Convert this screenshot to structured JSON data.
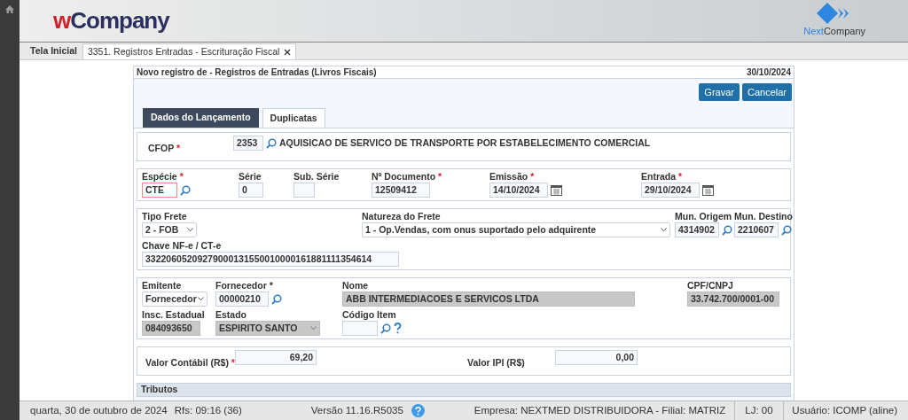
{
  "header": {
    "logo": {
      "accent": "w",
      "text": "Company"
    },
    "brand": {
      "accent": "Next",
      "text": "Company"
    }
  },
  "tabs": [
    {
      "label": "Tela Inicial",
      "selected": false
    },
    {
      "label": "3351. Registros Entradas - Escrituração Fiscal",
      "selected": true,
      "closable": true
    }
  ],
  "form": {
    "title": "Novo registro de - Registros de Entradas (Livros Fiscais)",
    "date": "30/10/2024",
    "buttons": [
      "Gravar",
      "Cancelar"
    ],
    "tabs": [
      {
        "label": "Dados do Lançamento",
        "selected": true
      },
      {
        "label": "Duplicatas",
        "selected": false
      }
    ],
    "sections": [
      {
        "kind": "inline",
        "rows": [
          [
            {
              "label": "CFOP",
              "mark": "*",
              "kind": "input",
              "value": "2353",
              "search": true,
              "description": "AQUISICAO DE SERVICO DE TRANSPORTE POR ESTABELECIMENTO COMERCIAL"
            }
          ]
        ]
      },
      {
        "kind": "stacked",
        "rows": [
          [
            {
              "label": "Espécie",
              "mark": "*",
              "kind": "input",
              "value": "CTE",
              "invalid": true,
              "search": true
            },
            {
              "label": "Série",
              "kind": "input",
              "value": "0"
            },
            {
              "label": "Sub. Série",
              "kind": "input"
            },
            {
              "label": "Nº Documento",
              "mark": "*",
              "kind": "input",
              "value": "12509412"
            },
            {
              "label": "Emissão",
              "mark": "*",
              "kind": "date",
              "value": "14/10/2024"
            },
            {
              "label": "Entrada",
              "mark": "*",
              "kind": "date",
              "value": "29/10/2024"
            }
          ]
        ]
      },
      {
        "kind": "stacked",
        "rows": [
          [
            {
              "label": "Tipo Frete",
              "kind": "select",
              "value": "2 - FOB"
            },
            {
              "label": "Natureza do Frete",
              "kind": "select",
              "value": "1 - Op.Vendas, com onus suportado pelo adquirente"
            },
            {
              "label": "Mun. Origem",
              "kind": "input",
              "value": "4314902",
              "search": true
            },
            {
              "label": "Mun. Destino",
              "kind": "input",
              "value": "2210607",
              "search": true
            }
          ],
          [
            {
              "label": "Chave NF-e / CT-e",
              "kind": "input",
              "value": "33220605209279000131550010000161881111354614"
            }
          ]
        ]
      },
      {
        "kind": "stacked",
        "rows": [
          [
            {
              "label": "Emitente",
              "kind": "select",
              "value": "Fornecedor"
            },
            {
              "label": "Fornecedor *",
              "kind": "input",
              "value": "00000210",
              "search": true
            },
            {
              "label": "Nome",
              "kind": "readonly",
              "value": "ABB INTERMEDIACOES E SERVICOS LTDA"
            },
            {
              "label": "CPF/CNPJ",
              "kind": "readonly",
              "value": "33.742.700/0001-00"
            }
          ],
          [
            {
              "label": "Insc. Estadual",
              "kind": "readonly",
              "value": "084093650"
            },
            {
              "label": "Estado",
              "kind": "readonly_select",
              "value": "ESPIRITO SANTO"
            },
            {
              "label": "Código Item",
              "kind": "input",
              "search": true,
              "help": true
            }
          ]
        ]
      },
      {
        "kind": "inline",
        "rows": [
          [
            {
              "label": "Valor Contábil (R$)",
              "mark": "*",
              "kind": "amount",
              "value": "69,20"
            },
            {
              "label": "Valor IPI (R$)",
              "kind": "amount",
              "value": "0,00"
            }
          ]
        ]
      }
    ],
    "tributos": {
      "title": "Tributos"
    }
  },
  "status_bar": {
    "date": "quarta, 30 de outubro de 2024",
    "refresh": "Rfs: 09:16 (36)",
    "version": "Versão 11.16.R5035",
    "company": "Empresa: NEXTMED DISTRIBUIDORA - Filial: MATRIZ",
    "store": "LJ: 00",
    "user": "Usuário: ICOMP (aline)"
  }
}
